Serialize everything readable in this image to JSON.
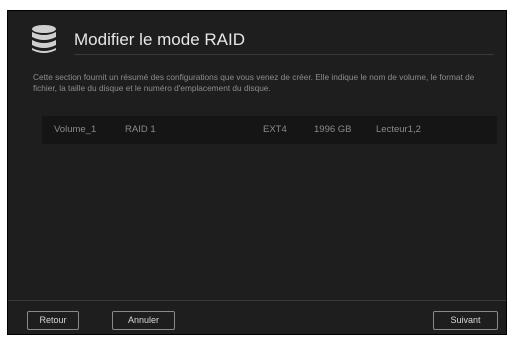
{
  "dialog": {
    "icon": "database-icon",
    "title": "Modifier le mode RAID",
    "description": "Cette section fournit un résumé des configurations que vous venez de créer. Elle indique le nom de volume, le format de fichier, la taille du disque et le numéro d'emplacement du disque."
  },
  "volumes": [
    {
      "name": "Volume_1",
      "raid_mode": "RAID 1",
      "file_format": "EXT4",
      "size": "1996 GB",
      "drives": "Lecteur1,2"
    }
  ],
  "buttons": {
    "back": "Retour",
    "cancel": "Annuler",
    "next": "Suivant"
  },
  "colors": {
    "dialog_background": "#1e1e1e",
    "row_background": "#151515",
    "title_text": "#e6e6e6",
    "muted_text": "#8c8c8c"
  }
}
